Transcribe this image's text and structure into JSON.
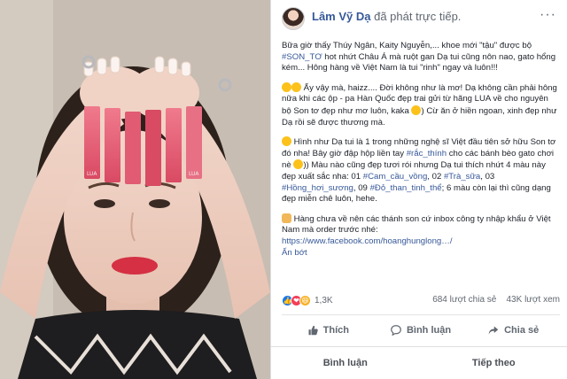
{
  "post": {
    "author": "Lâm Vỹ Dạ",
    "action": "đã phát trực tiếp.",
    "more": "···",
    "paragraphs": {
      "p1a": "Bữa giờ thấy Thúy Ngân, Kaity Nguyễn,... khoe mới \"tậu\" được bộ ",
      "p1tag": "#SON_TƠ",
      "p1b": " hot nhứt Châu Á mà ruột gan Dạ tui cũng nôn nao, gato hổng kém... Hông hàng về Việt Nam là tui \"rinh\" ngay và luôn!!!",
      "p2a": " Ấy vậy mà, haizz.... Đời không như là mơ! Dạ không cần phải hông nữa khi các ộp - pa Hàn Quốc đẹp trai gửi từ hãng LUA về cho nguyên bộ Son tơ đẹp như mơ luôn, kaka ",
      "p2b": ") Cừ ăn ở hiền ngoan, xinh đẹp như Dạ rồi sẽ được thương mà.",
      "p3a": " Hình như Dạ tui là 1 trong những nghệ sĩ Việt đầu tiên sở hữu Son tơ đó nha! Bây giờ đập hộp liền tay ",
      "p3tag": "#rắc_thính",
      "p3b": " cho các bánh bèo gato chơi nè ",
      "p3c": ")) Màu nào cũng đẹp tươi rói nhưng Dạ tui thích nhứt 4 màu này đẹp xuất sắc nha: 01 ",
      "tag1": "#Cam_cầu_vồng",
      "p3d": ", 02 ",
      "tag2": "#Trà_sữa",
      "p3e": ", 03 ",
      "tag3": "#Hồng_hơi_sương",
      "p3f": ", 09 ",
      "tag4": "#Đỏ_than_tinh_thể",
      "p3g": "; 6 màu còn lại thì cũng dạng đẹp miễn chê luôn, hehe.",
      "p4a": " Hàng chưa về nên các thánh son cứ inbox công ty nhập khẩu ở Việt Nam mà order trước nhé:",
      "p4link": "https://www.facebook.com/hoanghunglong…/",
      "seemore": "Ẩn bớt"
    }
  },
  "stats": {
    "reactions_count": "1,3K",
    "shares": "684 lượt chia sẻ",
    "views": "43K lượt xem"
  },
  "actions": {
    "like": "Thích",
    "comment": "Bình luận",
    "share": "Chia sẻ"
  },
  "bottom": {
    "comments": "Bình luận",
    "follow": "Tiếp theo"
  },
  "colors": {
    "link": "#365899",
    "accent": "#1877f2",
    "lipstick": "#e2566f"
  },
  "icons": {
    "like": "thumbs-up",
    "love": "heart",
    "haha": "laughing-face"
  }
}
